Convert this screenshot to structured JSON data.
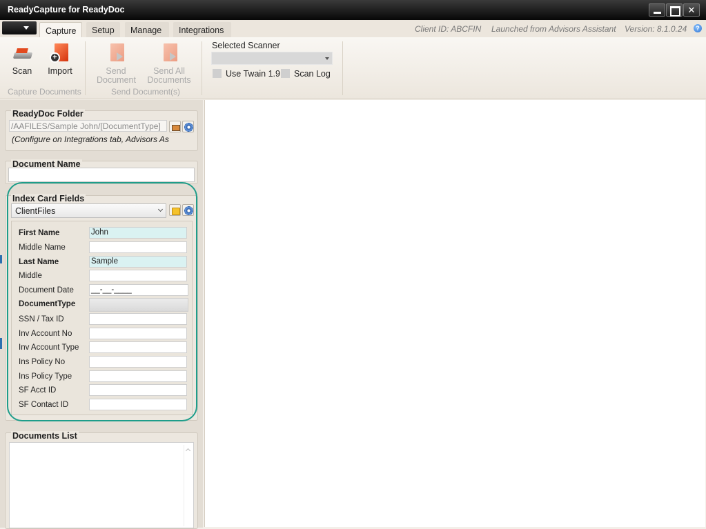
{
  "window": {
    "title": "ReadyCapture for ReadyDoc"
  },
  "tabs": {
    "capture": "Capture",
    "setup": "Setup",
    "manage": "Manage",
    "integrations": "Integrations"
  },
  "status": {
    "client_id": "Client ID: ABCFIN",
    "launched_from": "Launched from Advisors Assistant",
    "version": "Version: 8.1.0.24"
  },
  "ribbon": {
    "scan_label": "Scan",
    "import_label": "Import",
    "send_document_line1": "Send",
    "send_document_line2": "Document",
    "send_all_line1": "Send All",
    "send_all_line2": "Documents",
    "group_capture": "Capture Documents",
    "group_send": "Send Document(s)",
    "selected_scanner_label": "Selected Scanner",
    "selected_scanner_value": "",
    "use_twain_label": "Use Twain 1.9",
    "scan_log_label": "Scan Log"
  },
  "folder": {
    "title": "ReadyDoc Folder",
    "path": "/AAFILES/Sample John/[DocumentType]",
    "note": "(Configure on Integrations tab, Advisors As"
  },
  "document_name": {
    "title": "Document Name",
    "value": ""
  },
  "index_card": {
    "title": "Index Card Fields",
    "selected": "ClientFiles",
    "fields": [
      {
        "label": "First Name",
        "value": "John"
      },
      {
        "label": "Middle Name",
        "value": ""
      },
      {
        "label": "Last Name",
        "value": "Sample"
      },
      {
        "label": "Middle",
        "value": ""
      },
      {
        "label": "Document Date",
        "value": "__-__-____"
      },
      {
        "label": "DocumentType",
        "value": ""
      },
      {
        "label": "SSN / Tax ID",
        "value": ""
      },
      {
        "label": "Inv Account No",
        "value": ""
      },
      {
        "label": "Inv Account Type",
        "value": ""
      },
      {
        "label": "Ins Policy No",
        "value": ""
      },
      {
        "label": "Ins Policy Type",
        "value": ""
      },
      {
        "label": "SF Acct ID",
        "value": ""
      },
      {
        "label": "SF Contact ID",
        "value": ""
      }
    ]
  },
  "documents_list": {
    "title": "Documents List"
  },
  "colors": {
    "highlight": "#1e9d8a",
    "filled_field": "#daf2f2"
  }
}
